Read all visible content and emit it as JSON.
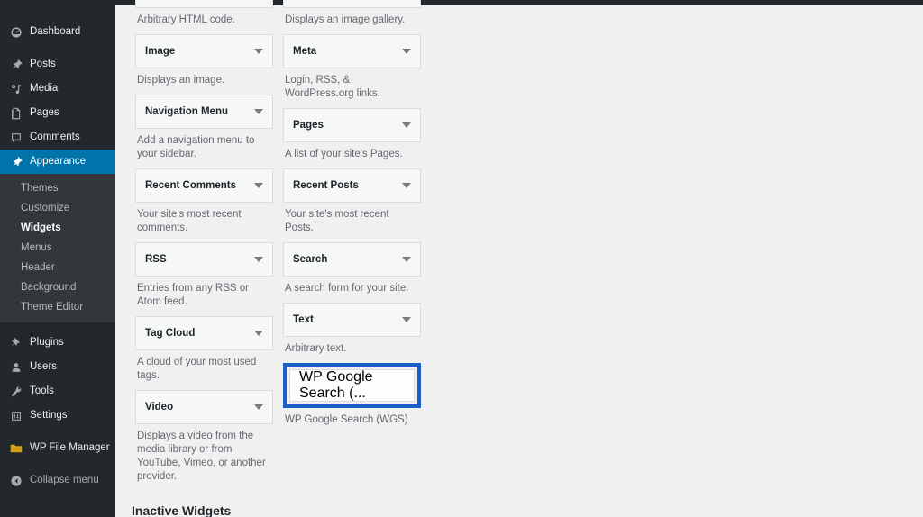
{
  "app": {
    "name": "WordPress Admin",
    "screen": "Widgets",
    "accent_color": "#0073aa",
    "sidebar_bg": "#23282d",
    "submenu_bg": "#32373c",
    "content_bg": "#f0f0f1",
    "highlight_color": "#1a5fc4"
  },
  "sidebar": {
    "items": [
      {
        "label": "Dashboard",
        "icon": "dashboard-icon",
        "active": false
      },
      {
        "label": "Posts",
        "icon": "pin-icon",
        "active": false
      },
      {
        "label": "Media",
        "icon": "media-icon",
        "active": false
      },
      {
        "label": "Pages",
        "icon": "pages-icon",
        "active": false
      },
      {
        "label": "Comments",
        "icon": "comments-icon",
        "active": false
      },
      {
        "label": "Appearance",
        "icon": "appearance-icon",
        "active": true
      },
      {
        "label": "Plugins",
        "icon": "plugins-icon",
        "active": false
      },
      {
        "label": "Users",
        "icon": "users-icon",
        "active": false
      },
      {
        "label": "Tools",
        "icon": "tools-icon",
        "active": false
      },
      {
        "label": "Settings",
        "icon": "settings-icon",
        "active": false
      },
      {
        "label": "WP File Manager",
        "icon": "folder-icon",
        "active": false
      },
      {
        "label": "Collapse menu",
        "icon": "collapse-icon",
        "active": false
      }
    ],
    "appearance_submenu": [
      {
        "label": "Themes",
        "current": false
      },
      {
        "label": "Customize",
        "current": false
      },
      {
        "label": "Widgets",
        "current": true
      },
      {
        "label": "Menus",
        "current": false
      },
      {
        "label": "Header",
        "current": false
      },
      {
        "label": "Background",
        "current": false
      },
      {
        "label": "Theme Editor",
        "current": false
      }
    ]
  },
  "main": {
    "inactive_widgets_heading": "Inactive Widgets",
    "left_column": [
      {
        "title": "",
        "description": "Arbitrary HTML code.",
        "clipped": true,
        "highlight": false
      },
      {
        "title": "Image",
        "description": "Displays an image.",
        "clipped": false,
        "highlight": false
      },
      {
        "title": "Navigation Menu",
        "description": "Add a navigation menu to your sidebar.",
        "clipped": false,
        "highlight": false
      },
      {
        "title": "Recent Comments",
        "description": "Your site's most recent comments.",
        "clipped": false,
        "highlight": false
      },
      {
        "title": "RSS",
        "description": "Entries from any RSS or Atom feed.",
        "clipped": false,
        "highlight": false
      },
      {
        "title": "Tag Cloud",
        "description": "A cloud of your most used tags.",
        "clipped": false,
        "highlight": false
      },
      {
        "title": "Video",
        "description": "Displays a video from the media library or from YouTube, Vimeo, or another provider.",
        "clipped": false,
        "highlight": false
      }
    ],
    "right_column": [
      {
        "title": "",
        "description": "Displays an image gallery.",
        "clipped": true,
        "highlight": false
      },
      {
        "title": "Meta",
        "description": "Login, RSS, & WordPress.org links.",
        "clipped": false,
        "highlight": false
      },
      {
        "title": "Pages",
        "description": "A list of your site's Pages.",
        "clipped": false,
        "highlight": false
      },
      {
        "title": "Recent Posts",
        "description": "Your site's most recent Posts.",
        "clipped": false,
        "highlight": false
      },
      {
        "title": "Search",
        "description": "A search form for your site.",
        "clipped": false,
        "highlight": false
      },
      {
        "title": "Text",
        "description": "Arbitrary text.",
        "clipped": false,
        "highlight": false
      },
      {
        "title": "WP Google Search (...",
        "description": "WP Google Search (WGS)",
        "clipped": false,
        "highlight": true
      }
    ]
  }
}
